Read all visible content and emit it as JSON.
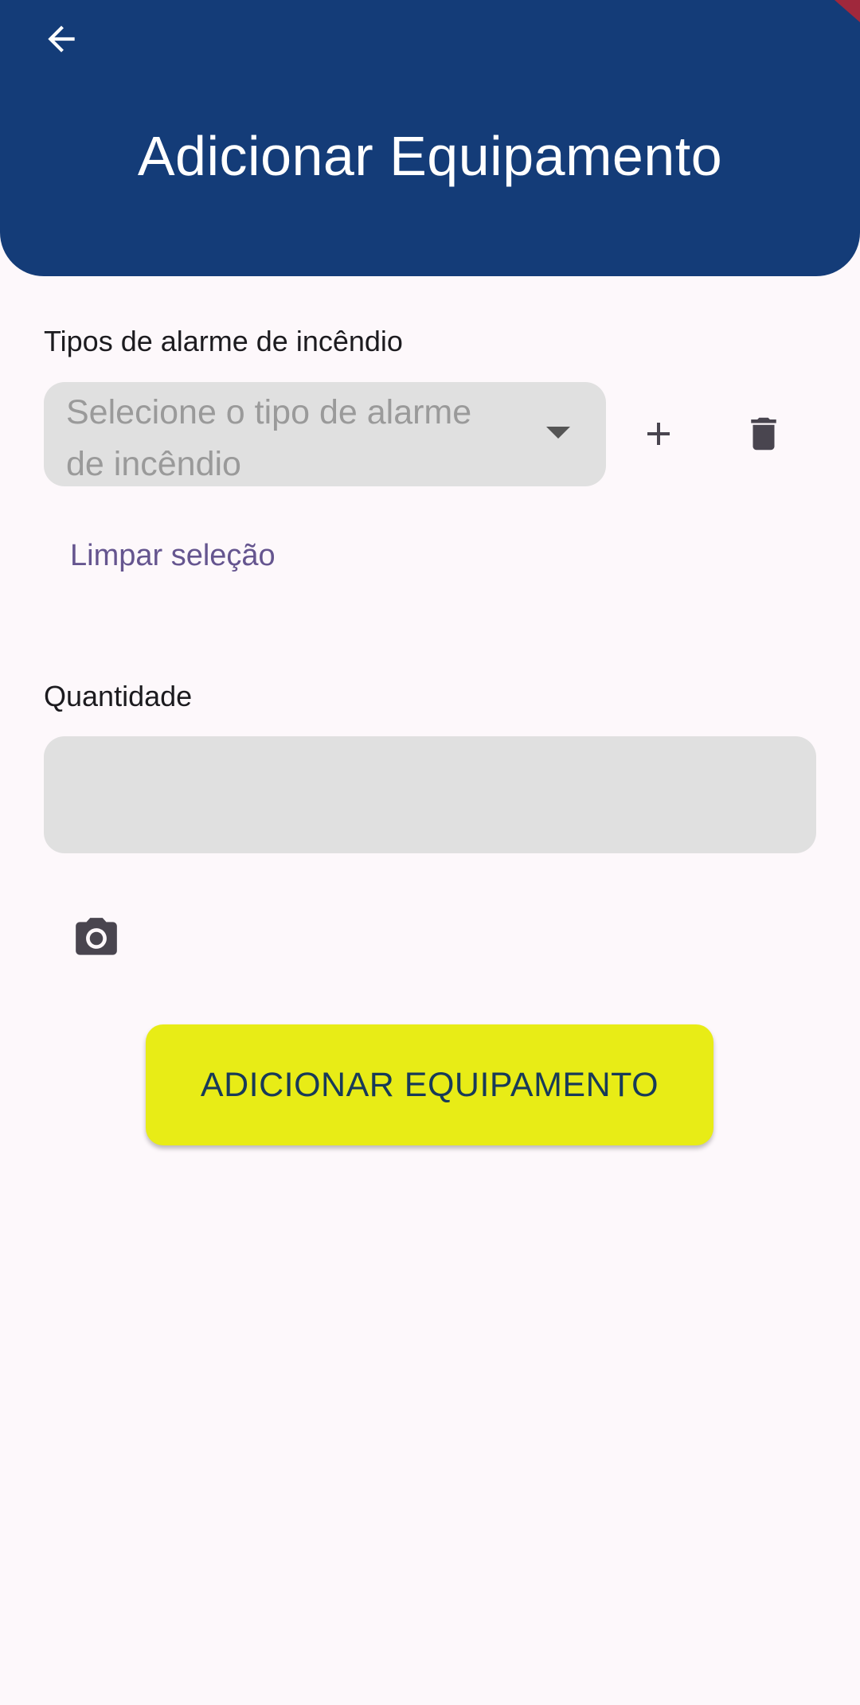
{
  "app_bar": {
    "title": "Adicionar Equipamento",
    "back_icon": "arrow-left-icon",
    "background_color": "#143c78"
  },
  "alarm_type": {
    "label": "Tipos de alarme de incêndio",
    "dropdown_placeholder": "Selecione o tipo de alarme de incêndio",
    "add_icon": "plus-icon",
    "delete_icon": "trash-icon",
    "clear_selection_label": "Limpar seleção"
  },
  "quantity": {
    "label": "Quantidade",
    "value": ""
  },
  "photo": {
    "icon": "camera-icon"
  },
  "submit": {
    "label": "ADICIONAR EQUIPAMENTO",
    "background_color": "#e8ec16",
    "text_color": "#183a58"
  }
}
